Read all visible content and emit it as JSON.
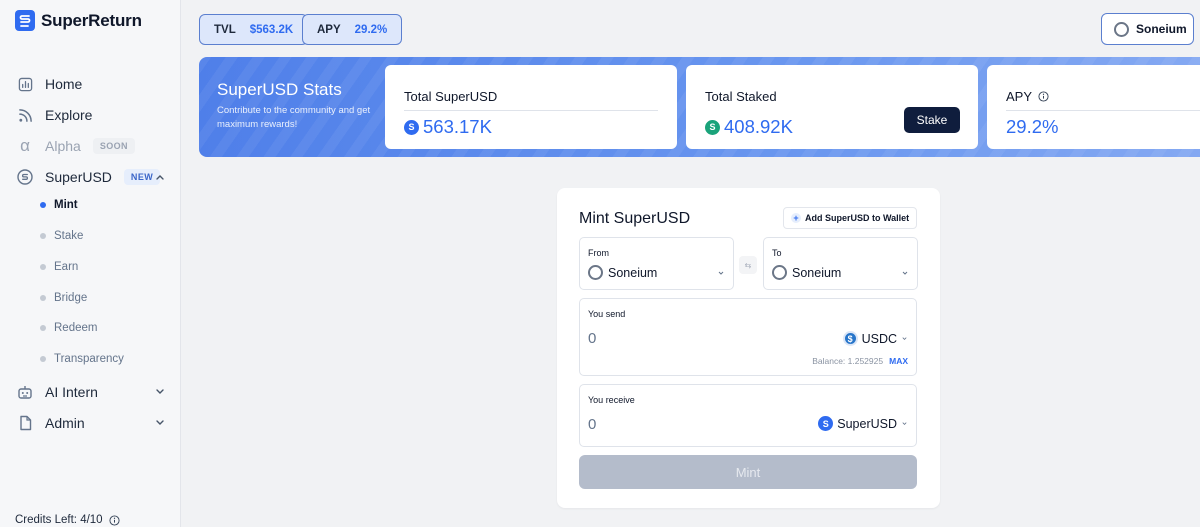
{
  "app": {
    "name": "SuperReturn",
    "brand_color": "#2f6bf0"
  },
  "sidebar": {
    "items": [
      {
        "label": "Home",
        "icon": "chart-icon"
      },
      {
        "label": "Explore",
        "icon": "rss-icon"
      },
      {
        "label": "Alpha",
        "icon": "alpha-icon",
        "badge": "SOON",
        "disabled": true
      },
      {
        "label": "SuperUSD",
        "icon": "superusd-icon",
        "badge": "NEW",
        "expanded": true
      },
      {
        "label": "AI Intern",
        "icon": "robot-icon"
      },
      {
        "label": "Admin",
        "icon": "document-icon"
      }
    ],
    "superusd_subitems": [
      "Mint",
      "Stake",
      "Earn",
      "Bridge",
      "Redeem",
      "Transparency"
    ],
    "active_subitem": "Mint",
    "credits": "Credits Left: 4/10"
  },
  "header": {
    "tvl_label": "TVL",
    "tvl_value": "$563.2K",
    "apy_label": "APY",
    "apy_value": "29.2%",
    "network": "Soneium"
  },
  "banner": {
    "title": "SuperUSD Stats",
    "subtitle": "Contribute to the community and get maximum rewards!",
    "stats": [
      {
        "label": "Total SuperUSD",
        "value": "563.17K"
      },
      {
        "label": "Total Staked",
        "value": "408.92K",
        "button": "Stake"
      },
      {
        "label": "APY",
        "value": "29.2%"
      }
    ]
  },
  "mint": {
    "title": "Mint SuperUSD",
    "add_wallet": "Add SuperUSD to Wallet",
    "from_label": "From",
    "from_network": "Soneium",
    "to_label": "To",
    "to_network": "Soneium",
    "send_label": "You send",
    "send_amount": "0",
    "send_token": "USDC",
    "balance": "Balance: 1.252925",
    "max": "MAX",
    "receive_label": "You receive",
    "receive_amount": "0",
    "receive_token": "SuperUSD",
    "button": "Mint"
  }
}
